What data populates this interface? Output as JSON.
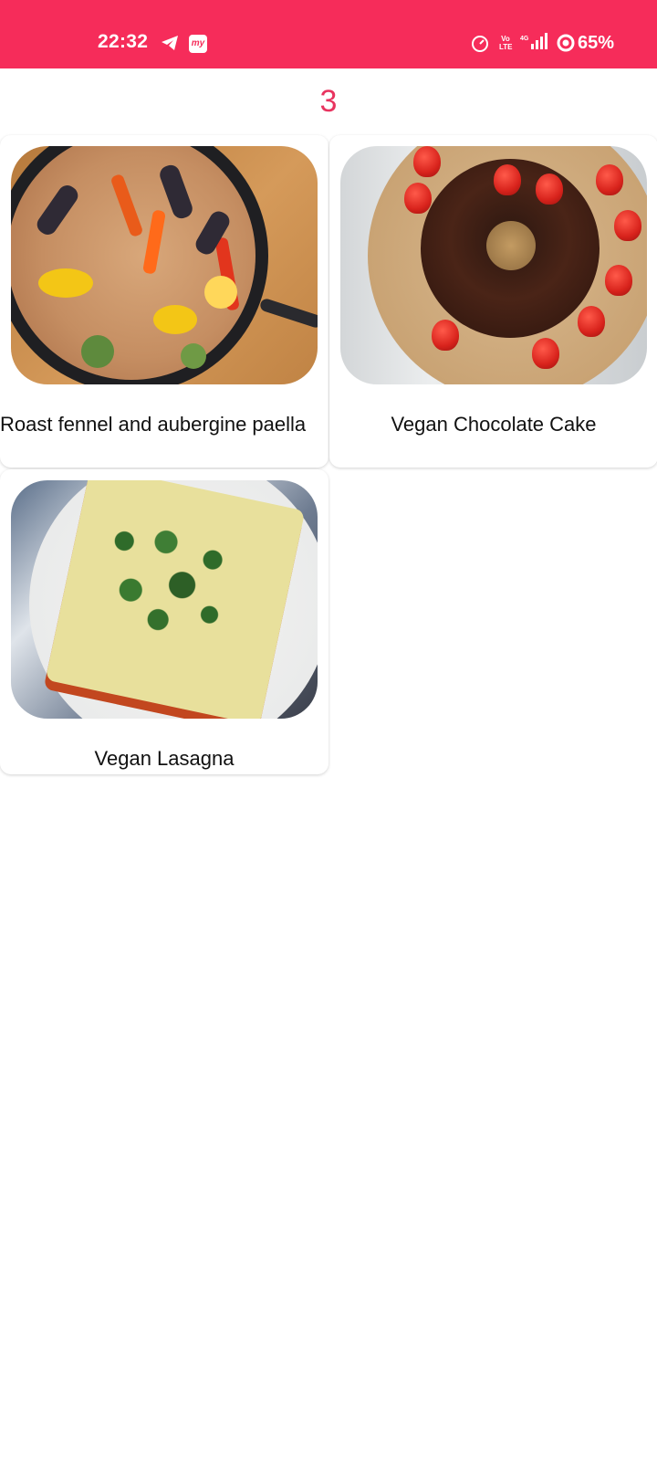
{
  "status_bar": {
    "time": "22:32",
    "icons": [
      "telegram-icon",
      "my-app-icon",
      "data-speed-icon",
      "volte-icon",
      "signal-4g-icon",
      "ring-icon"
    ],
    "volte_label": "Vo LTE",
    "my_icon_label": "my",
    "battery": "65%",
    "color": "#f62c5a"
  },
  "page": {
    "count": "3",
    "count_color": "#e8345f"
  },
  "recipes": [
    {
      "title": "Roast fennel and aubergine paella",
      "image": "paella-photo"
    },
    {
      "title": "Vegan Chocolate Cake",
      "image": "chocolate-cake-photo"
    },
    {
      "title": "Vegan Lasagna",
      "image": "lasagna-photo"
    }
  ]
}
